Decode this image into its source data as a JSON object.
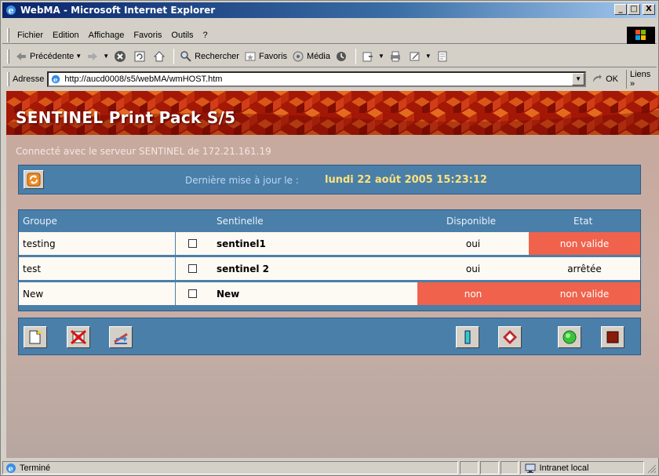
{
  "window": {
    "title": "WebMA - Microsoft Internet Explorer",
    "buttons": {
      "minimize": "_",
      "maximize": "□",
      "close": "X"
    }
  },
  "menu": {
    "items": [
      {
        "label": "Fichier"
      },
      {
        "label": "Edition"
      },
      {
        "label": "Affichage"
      },
      {
        "label": "Favoris"
      },
      {
        "label": "Outils"
      },
      {
        "label": "?"
      }
    ]
  },
  "toolbar": {
    "back_label": "Précédente",
    "search_label": "Rechercher",
    "favorites_label": "Favoris",
    "media_label": "Média"
  },
  "address": {
    "label": "Adresse",
    "url": "http://aucd0008/s5/webMA/wmHOST.htm",
    "go_label": "OK",
    "links_label": "Liens »"
  },
  "page": {
    "banner_title": "SENTINEL Print Pack S/5",
    "connected_text": "Connecté avec le serveur SENTINEL de 172.21.161.19",
    "update_label": "Dernière mise à jour le :",
    "update_value": "lundi 22 août 2005 15:23:12",
    "table": {
      "headers": {
        "group": "Groupe",
        "sentinel": "Sentinelle",
        "available": "Disponible",
        "state": "Etat"
      },
      "rows": [
        {
          "group": "testing",
          "sentinel": "sentinel1",
          "available": "oui",
          "state": "non valide",
          "available_alert": false,
          "state_alert": true
        },
        {
          "group": "test",
          "sentinel": "sentinel 2",
          "available": "oui",
          "state": "arrêtée",
          "available_alert": false,
          "state_alert": false
        },
        {
          "group": "New",
          "sentinel": "New",
          "available": "non",
          "state": "non valide",
          "available_alert": true,
          "state_alert": true
        }
      ]
    }
  },
  "status": {
    "text": "Terminé",
    "zone": "Intranet local"
  },
  "colors": {
    "panel_blue": "#4a7faa",
    "alert_red": "#f0624c",
    "update_yellow": "#ffe37a"
  }
}
